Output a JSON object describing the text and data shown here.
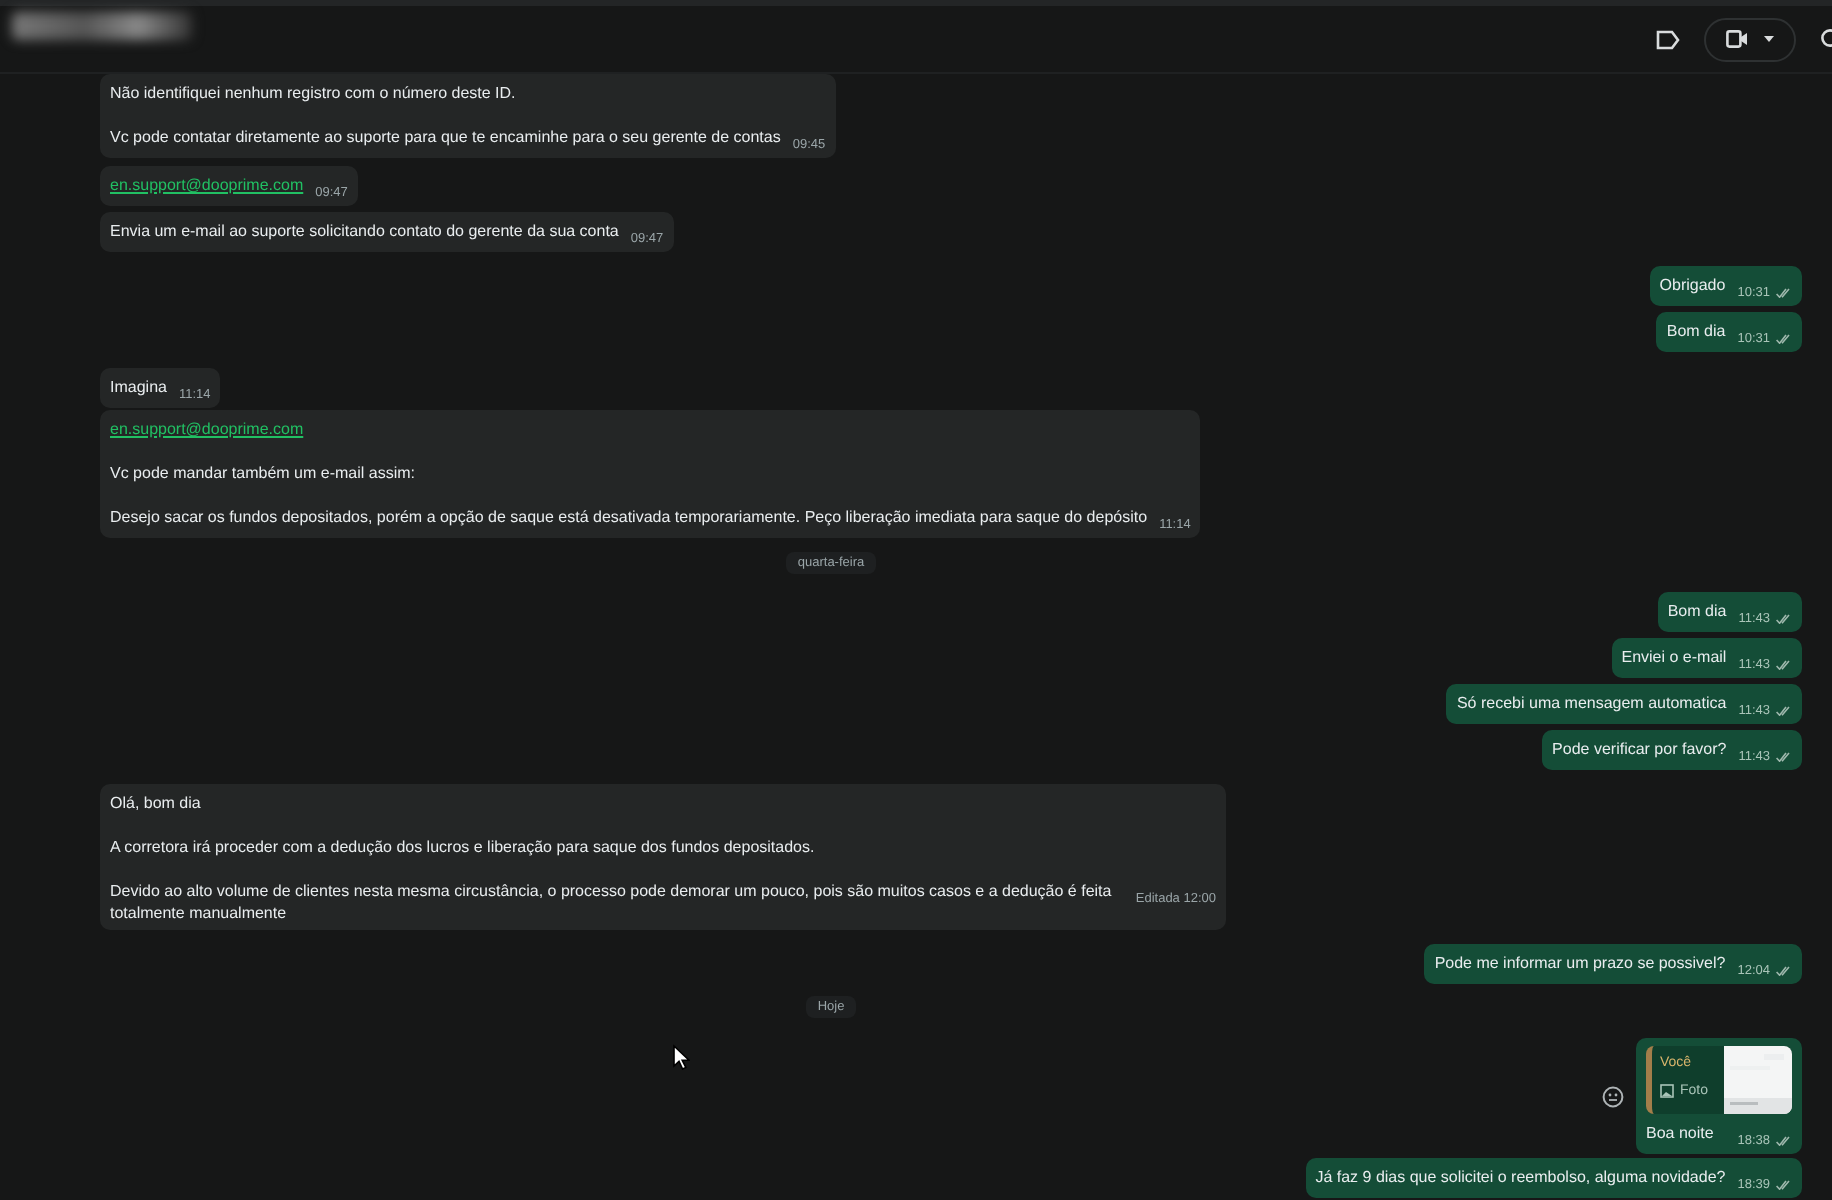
{
  "header": {
    "actions": [
      {
        "kind": "label"
      },
      {
        "kind": "video"
      },
      {
        "kind": "search"
      }
    ]
  },
  "messages": [
    {
      "kind": "incoming",
      "paragraphs": [
        {
          "kind": "text",
          "text": "Não identifiquei nenhum registro com o número deste ID."
        },
        {
          "kind": "text",
          "text": "Vc pode contatar diretamente ao suporte para que te encaminhe para o seu gerente de contas"
        }
      ],
      "time": "09:45"
    },
    {
      "kind": "incoming",
      "paragraphs": [
        {
          "kind": "link",
          "text": "en.support@dooprime.com"
        }
      ],
      "time": "09:47"
    },
    {
      "kind": "incoming",
      "paragraphs": [
        {
          "kind": "text",
          "text": "Envia um e-mail ao suporte solicitando contato do gerente da sua conta"
        }
      ],
      "time": "09:47"
    },
    {
      "kind": "outgoing",
      "paragraphs": [
        {
          "kind": "text",
          "text": "Obrigado"
        }
      ],
      "time": "10:31"
    },
    {
      "kind": "outgoing",
      "paragraphs": [
        {
          "kind": "text",
          "text": "Bom dia"
        }
      ],
      "time": "10:31"
    },
    {
      "kind": "incoming",
      "paragraphs": [
        {
          "kind": "text",
          "text": "Imagina"
        }
      ],
      "time": "11:14"
    },
    {
      "kind": "incoming",
      "paragraphs": [
        {
          "kind": "link",
          "text": "en.support@dooprime.com"
        },
        {
          "kind": "text",
          "text": "Vc pode mandar também um e-mail assim:"
        },
        {
          "kind": "text",
          "text": "Desejo sacar os fundos depositados, porém a opção de saque está desativada temporariamente. Peço liberação imediata para saque do depósito"
        }
      ],
      "time": "11:14"
    },
    {
      "kind": "date",
      "text": "quarta-feira"
    },
    {
      "kind": "outgoing",
      "paragraphs": [
        {
          "kind": "text",
          "text": "Bom dia"
        }
      ],
      "time": "11:43"
    },
    {
      "kind": "outgoing",
      "paragraphs": [
        {
          "kind": "text",
          "text": "Enviei o e-mail"
        }
      ],
      "time": "11:43"
    },
    {
      "kind": "outgoing",
      "paragraphs": [
        {
          "kind": "text",
          "text": "Só recebi uma mensagem automatica"
        }
      ],
      "time": "11:43"
    },
    {
      "kind": "outgoing",
      "paragraphs": [
        {
          "kind": "text",
          "text": "Pode verificar por favor?"
        }
      ],
      "time": "11:43"
    },
    {
      "kind": "incoming",
      "paragraphs": [
        {
          "kind": "text",
          "text": "Olá, bom dia"
        },
        {
          "kind": "text",
          "text": "A corretora irá proceder com a dedução dos lucros e liberação para saque dos fundos depositados."
        },
        {
          "kind": "text",
          "text": "Devido ao alto volume de clientes nesta mesma circustância, o processo pode demorar um pouco, pois são muitos casos e a dedução é feita totalmente manualmente"
        }
      ],
      "time": "Editada 12:00"
    },
    {
      "kind": "outgoing",
      "paragraphs": [
        {
          "kind": "text",
          "text": "Pode me informar um prazo se possivel?"
        }
      ],
      "time": "12:04"
    },
    {
      "kind": "date",
      "text": "Hoje"
    },
    {
      "kind": "outgoing",
      "reply": {
        "author": "Você",
        "label": "Foto"
      },
      "paragraphs": [
        {
          "kind": "text",
          "text": "Boa noite"
        }
      ],
      "time": "18:38"
    },
    {
      "kind": "outgoing",
      "paragraphs": [
        {
          "kind": "text",
          "text": "Já faz 9 dias que solicitei o reembolso, alguma novidade?"
        }
      ],
      "time": "18:39"
    }
  ]
}
